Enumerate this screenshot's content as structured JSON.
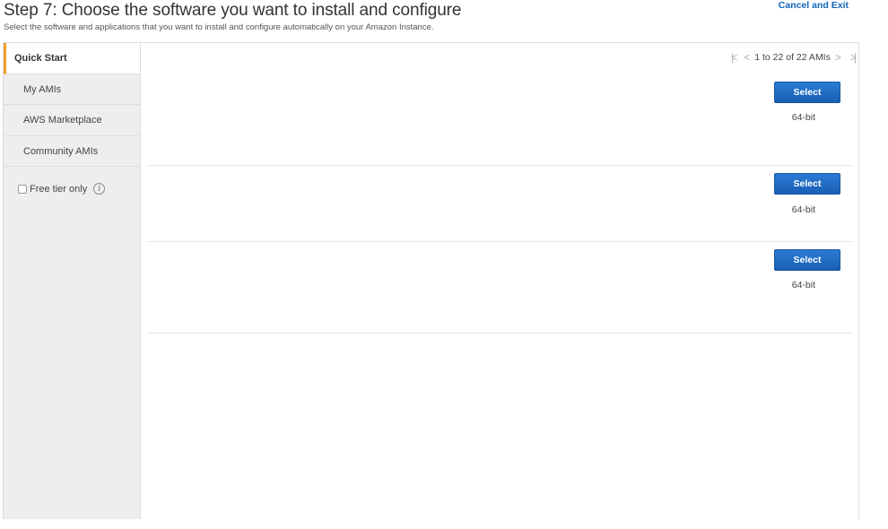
{
  "header": {
    "title": "Step 7: Choose the software you want to install and configure",
    "subtitle": "Select the software and applications that you want to install and configure automatically on your Amazon Instance.",
    "cancel_label": "Cancel and Exit"
  },
  "sidebar": {
    "items": [
      {
        "label": "Quick Start",
        "active": true
      },
      {
        "label": "My AMIs"
      },
      {
        "label": "AWS Marketplace"
      },
      {
        "label": "Community AMIs"
      }
    ],
    "filter_label": "Free tier only",
    "filter_checked": false,
    "info_glyph": "i"
  },
  "pager": {
    "first_icon": "first-page-icon",
    "prev_icon": "chevron-left-icon",
    "range_text": "1 to 22 of 22 AMIs",
    "next_icon": "chevron-right-icon",
    "last_icon": "last-page-icon"
  },
  "amis": [
    {
      "select_label": "Select",
      "architecture": "64-bit"
    },
    {
      "select_label": "Select",
      "architecture": "64-bit"
    },
    {
      "select_label": "Select",
      "architecture": "64-bit"
    }
  ],
  "colors": {
    "accent_tab": "#f0a030",
    "button_blue": "#1a5fb4",
    "link_blue": "#1166bb"
  }
}
